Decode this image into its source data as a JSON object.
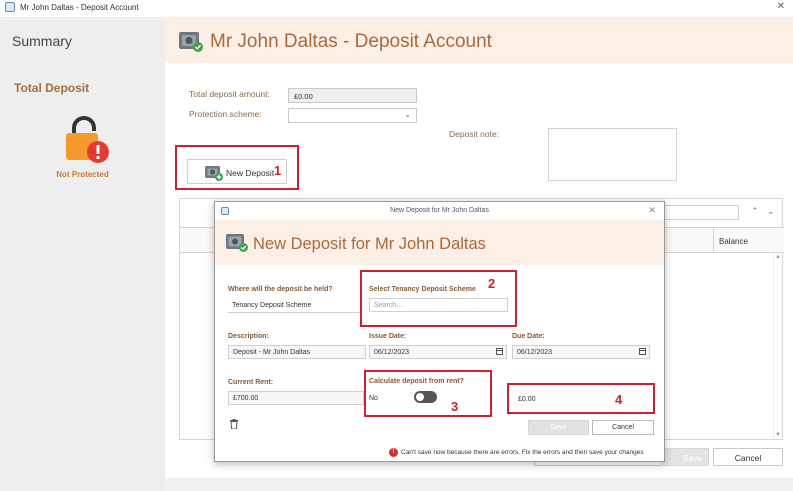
{
  "window": {
    "title": "Mr John Daltas - Deposit Account",
    "close_glyph": "✕"
  },
  "sidebar": {
    "summary": "Summary",
    "total_deposit": "Total Deposit",
    "status_text": "Not Protected",
    "status_icon": "padlock-warning-icon"
  },
  "header": {
    "title": "Mr John Daltas - Deposit Account",
    "icon": "safe-icon"
  },
  "form": {
    "total_deposit_label": "Total deposit amount:",
    "total_deposit_value": "£0.00",
    "protection_label": "Protection scheme:",
    "protection_value": "",
    "note_label": "Deposit note:",
    "new_deposit_button": "New Deposit"
  },
  "grid": {
    "balance_header": "Balance"
  },
  "footer": {
    "save_label": "Save",
    "cancel_label": "Cancel"
  },
  "modal": {
    "window_title": "New Deposit for Mr John Daltas",
    "header_title": "New Deposit for Mr John Daltas",
    "held_label": "Where will the deposit be held?",
    "held_value": "Tenancy Deposit Scheme",
    "scheme_label": "Select Tenancy Deposit Scheme",
    "scheme_placeholder": "Search...",
    "description_label": "Description:",
    "description_value": "Deposit - Mr John Daltas",
    "issue_date_label": "Issue Date:",
    "issue_date_value": "06/12/2023",
    "due_date_label": "Due Date:",
    "due_date_value": "06/12/2023",
    "rent_label": "Current Rent:",
    "rent_value": "£700.00",
    "calc_label": "Calculate deposit from rent?",
    "calc_value": "No",
    "amount_value": "£0.00",
    "save_label": "Save",
    "cancel_label": "Cancel",
    "error_text": "Can't save now because there are errors. Fix the errors and then save your changes"
  },
  "annotations": {
    "n1": "1",
    "n2": "2",
    "n3": "3",
    "n4": "4",
    "color": "#d01f2e"
  }
}
